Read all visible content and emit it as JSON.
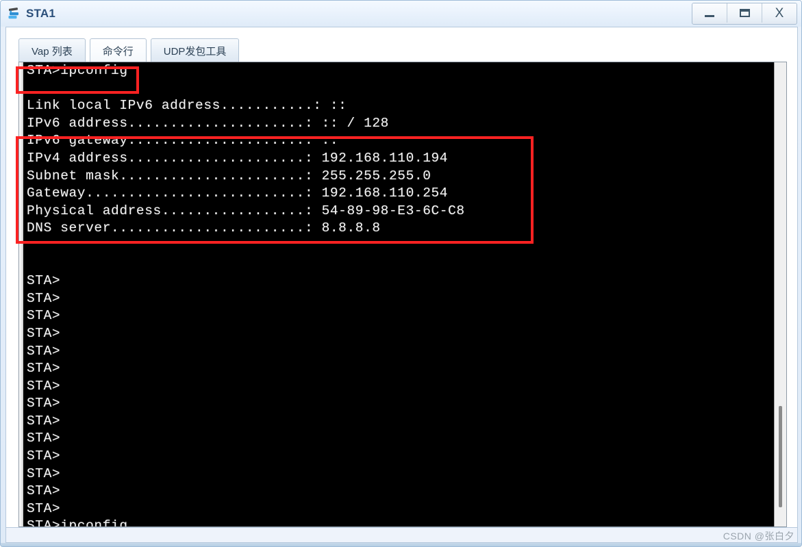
{
  "window": {
    "title": "STA1",
    "icon": "sta-device-icon",
    "controls": {
      "minimize": "_",
      "maximize": "▭",
      "close": "X"
    }
  },
  "tabs": [
    {
      "label": "Vap 列表",
      "name": "tab-vap-list",
      "active": false
    },
    {
      "label": "命令行",
      "name": "tab-command-line",
      "active": true
    },
    {
      "label": "UDP发包工具",
      "name": "tab-udp-tool",
      "active": false
    }
  ],
  "terminal": {
    "content": "STA>ipconfig\n\nLink local IPv6 address...........: ::\nIPv6 address.....................: :: / 128\nIPv6 gateway.....................: ::\nIPv4 address.....................: 192.168.110.194\nSubnet mask......................: 255.255.255.0\nGateway..........................: 192.168.110.254\nPhysical address.................: 54-89-98-E3-6C-C8\nDNS server.......................: 8.8.8.8\n\n\nSTA>\nSTA>\nSTA>\nSTA>\nSTA>\nSTA>\nSTA>\nSTA>\nSTA>\nSTA>\nSTA>\nSTA>\nSTA>\nSTA>\nSTA>ipconfig",
    "command": "STA>ipconfig",
    "prompt": "STA>",
    "fields": [
      {
        "label": "Link local IPv6 address",
        "value": "::"
      },
      {
        "label": "IPv6 address",
        "value": ":: / 128"
      },
      {
        "label": "IPv6 gateway",
        "value": "::"
      },
      {
        "label": "IPv4 address",
        "value": "192.168.110.194"
      },
      {
        "label": "Subnet mask",
        "value": "255.255.255.0"
      },
      {
        "label": "Gateway",
        "value": "192.168.110.254"
      },
      {
        "label": "Physical address",
        "value": "54-89-98-E3-6C-C8"
      },
      {
        "label": "DNS server",
        "value": "8.8.8.8"
      }
    ],
    "colors": {
      "background": "#000000",
      "text": "#f2f2f2",
      "annotation": "#fb2222"
    }
  },
  "annotations": [
    {
      "name": "redbox-command",
      "target": "STA>ipconfig"
    },
    {
      "name": "redbox-ipinfo",
      "target": "IPv6 gateway ... DNS server"
    }
  ],
  "watermark": "CSDN @张白夕"
}
